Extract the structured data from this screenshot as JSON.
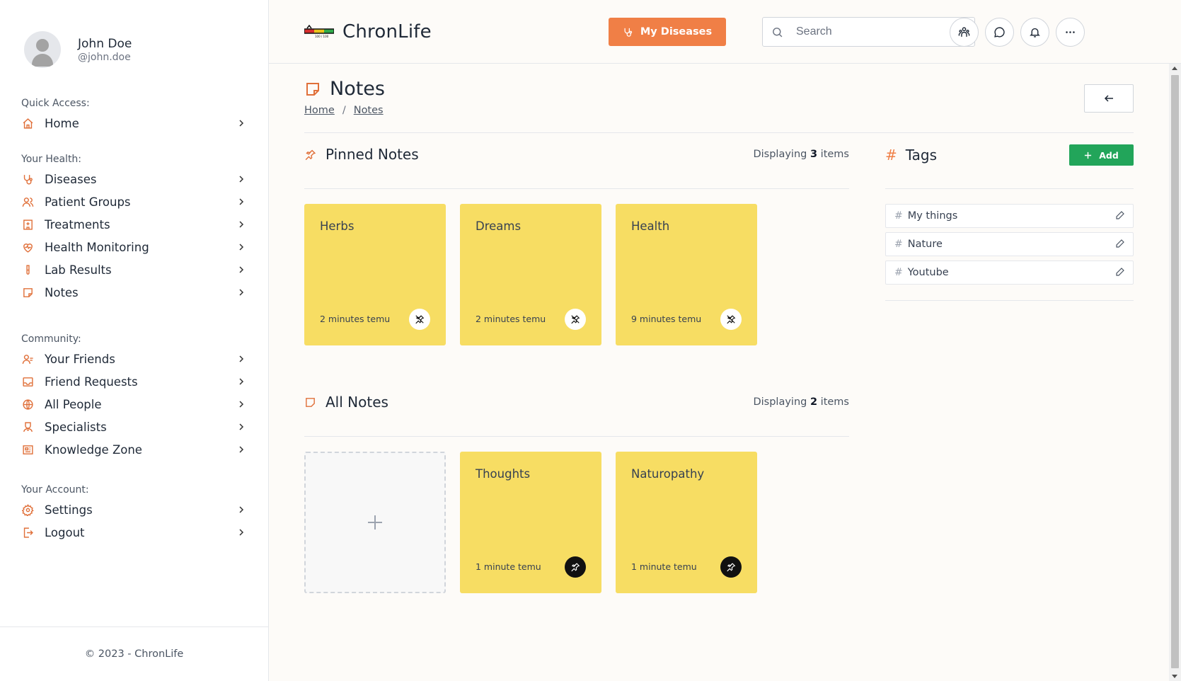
{
  "user": {
    "name": "John Doe",
    "handle": "@john.doe"
  },
  "sidebar": {
    "sections": [
      {
        "heading": "Quick Access:",
        "items": [
          {
            "label": "Home",
            "icon": "home-icon"
          }
        ]
      },
      {
        "heading": "Your Health:",
        "items": [
          {
            "label": "Diseases",
            "icon": "stethoscope-icon"
          },
          {
            "label": "Patient Groups",
            "icon": "users-icon"
          },
          {
            "label": "Treatments",
            "icon": "hospital-icon"
          },
          {
            "label": "Health Monitoring",
            "icon": "heart-pulse-icon"
          },
          {
            "label": "Lab Results",
            "icon": "test-tube-icon"
          },
          {
            "label": "Notes",
            "icon": "note-icon"
          }
        ]
      },
      {
        "heading": "Community:",
        "items": [
          {
            "label": "Your Friends",
            "icon": "user-check-icon"
          },
          {
            "label": "Friend Requests",
            "icon": "inbox-icon"
          },
          {
            "label": "All People",
            "icon": "globe-icon"
          },
          {
            "label": "Specialists",
            "icon": "doctor-icon"
          },
          {
            "label": "Knowledge Zone",
            "icon": "newspaper-icon"
          }
        ]
      },
      {
        "heading": "Your Account:",
        "items": [
          {
            "label": "Settings",
            "icon": "gear-icon"
          },
          {
            "label": "Logout",
            "icon": "logout-icon"
          }
        ]
      }
    ],
    "footer": "© 2023 - ChronLife"
  },
  "header": {
    "logo_text": "ChronLife",
    "logo_mark_text": "100 / 100",
    "my_diseases_label": "My Diseases",
    "search_placeholder": "Search",
    "icons": [
      "community-icon",
      "chat-icon",
      "bell-icon",
      "more-icon"
    ]
  },
  "page": {
    "title": "Notes",
    "breadcrumb": [
      "Home",
      "Notes"
    ]
  },
  "pinned": {
    "title": "Pinned Notes",
    "count_prefix": "Displaying",
    "count": "3",
    "count_suffix": "items",
    "notes": [
      {
        "title": "Herbs",
        "time": "2 minutes temu"
      },
      {
        "title": "Dreams",
        "time": "2 minutes temu"
      },
      {
        "title": "Health",
        "time": "9 minutes temu"
      }
    ]
  },
  "all": {
    "title": "All Notes",
    "count_prefix": "Displaying",
    "count": "2",
    "count_suffix": "items",
    "notes": [
      {
        "title": "Thoughts",
        "time": "1 minute temu"
      },
      {
        "title": "Naturopathy",
        "time": "1 minute temu"
      }
    ]
  },
  "tags": {
    "title": "Tags",
    "add_label": "Add",
    "items": [
      "My things",
      "Nature",
      "Youtube"
    ]
  },
  "colors": {
    "accent": "#f07f46",
    "note_yellow": "#f7dd63",
    "add_green": "#22a55a",
    "background": "#fdfbf8"
  }
}
